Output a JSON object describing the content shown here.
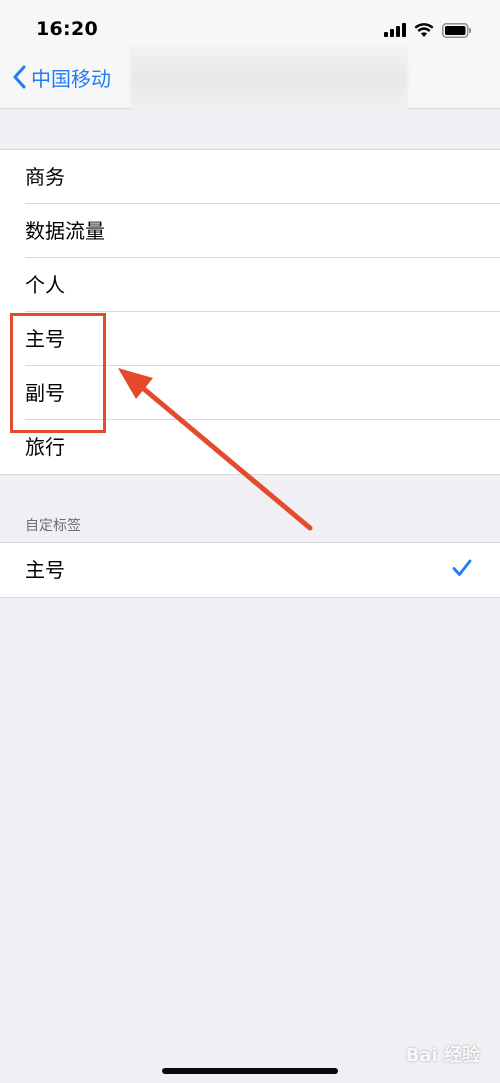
{
  "status_bar": {
    "time": "16:20"
  },
  "nav": {
    "back_label": "中国移动"
  },
  "label_list": {
    "items": [
      {
        "label": "商务"
      },
      {
        "label": "数据流量"
      },
      {
        "label": "个人"
      },
      {
        "label": "主号"
      },
      {
        "label": "副号"
      },
      {
        "label": "旅行"
      }
    ]
  },
  "custom": {
    "header": "自定标签",
    "items": [
      {
        "label": "主号",
        "selected": true
      }
    ]
  },
  "watermark": {
    "text": "Bai 经验"
  },
  "colors": {
    "accent": "#1f7cf5",
    "annotation": "#e34b2c",
    "background": "#efeff4"
  }
}
